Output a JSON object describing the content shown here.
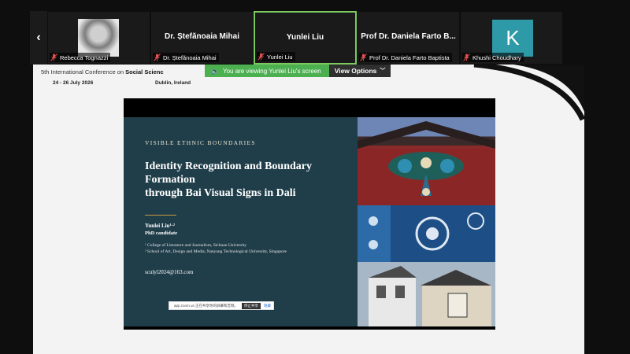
{
  "participants": [
    {
      "name": "Rebecca Tognazzi",
      "display": "photo"
    },
    {
      "name": "Dr. Ștefănoaia Mihai",
      "display": "name",
      "big_name": "Dr. Ștefănoaia Mihai"
    },
    {
      "name": "Yunlei Liu",
      "display": "name",
      "big_name": "Yunlei Liu",
      "active": true
    },
    {
      "name": "Prof Dr. Daniela Farto Baptista",
      "display": "name",
      "big_name": "Prof Dr. Daniela Farto B..."
    },
    {
      "name": "Khushi Choudhary",
      "display": "avatar",
      "initial": "K"
    }
  ],
  "viewing_banner": {
    "text": "You are viewing  Yunlei Liu's screen",
    "view_options": "View Options"
  },
  "conference": {
    "header_prefix": "5th International Conference on ",
    "header_bold": "Social Scienc",
    "dates": "24 - 26 July 2026",
    "location": "Dublin, Ireland"
  },
  "slide": {
    "kicker": "VISIBLE ETHNIC BOUNDARIES",
    "title_lines": [
      "Identity Recognition and Boundary",
      "Formation",
      "through Bai Visual Signs in Dali"
    ],
    "author": "Yunlei Liu¹·²",
    "role": "PhD candidate",
    "affiliation_1": "¹ College of Literature and Journalism, Sichuan University",
    "affiliation_2": "² School of Art, Design and Media, Nanyang Technological University, Singapore",
    "email": "sculyl2024@163.com"
  },
  "share_toast": {
    "text": "app.zoom.us 正在共享你的屏幕和音频。",
    "stop": "停止共享",
    "hide": "隐藏"
  },
  "colors": {
    "active_border": "#7ec85f",
    "banner_green": "#4caf50",
    "slide_bg": "#203e4a",
    "gold_rule": "#c79a3b",
    "avatar_k": "#2e9aa8"
  },
  "icons": {
    "prev": "chevron-left-icon",
    "muted": "mic-muted-icon",
    "speaker": "speaker-icon",
    "dropdown": "chevron-down-icon"
  }
}
